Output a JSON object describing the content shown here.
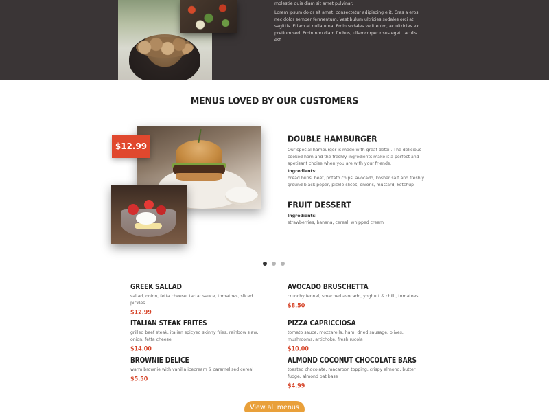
{
  "about": {
    "line1": "molestie quis diam sit amet pulvinar.",
    "paragraph": "Lorem ipsum dolor sit amet, consectetur adipiscing elit. Cras a eros nec dolor semper fermentum. Vestibulum ultricies sodales orci at sagittis. Etiam at nulla urna. Proin sodales velit enim, ac ultricies ex pretium sed. Proin non diam finibus, ullamcorper risus eget, iaculis est."
  },
  "section": {
    "title": "MENUS LOVED BY OUR CUSTOMERS"
  },
  "featured": {
    "price": "$12.99",
    "items": [
      {
        "title": "DOUBLE HAMBURGER",
        "description": "Our special hamburger is made with great detail. The delicious cooked ham and the freshly ingredients make it a perfect and apetisant choise when you are with your friends.",
        "ingredients_label": "Ingredients:",
        "ingredients": "bread buns, beef, potato chips, avocado, kosher salt and freshly ground black peper, pickle slices, onions, mustard, ketchup"
      },
      {
        "title": "FRUIT DESSERT",
        "ingredients_label": "Ingredients:",
        "ingredients": "strawberries, banana, cereal, whipped cream"
      }
    ],
    "slides": 3,
    "active_slide": 1
  },
  "menu": {
    "items": [
      {
        "name": "GREEK SALLAD",
        "description": "sallad, onion, fetta cheese, tartar sauce, tomatoes, sliced pickles",
        "price": "$12.99"
      },
      {
        "name": "AVOCADO BRUSCHETTA",
        "description": "crunchy fennel, smached avocado, yoghurt & chilli, tomatoes",
        "price": "$8.50"
      },
      {
        "name": "ITALIAN STEAK FRITES",
        "description": "grilled beef steak, italian spicyed skinny fries, rainbow slaw, onion, fetta cheese",
        "price": "$14.00"
      },
      {
        "name": "PIZZA CAPRICCIOSA",
        "description": "tomato sauce, mozzarella, ham, dried sausage, olives, mushrooms, artichoke, fresh rucola",
        "price": "$10.00"
      },
      {
        "name": "BROWNIE DELICE",
        "description": "warm brownie with vanilla icecream & caramelised cereal",
        "price": "$5.50"
      },
      {
        "name": "ALMOND COCONUT CHOCOLATE BARS",
        "description": "toasted chocolate, macaroon topping, crispy almond, butter fudge, almond oat base",
        "price": "$4.99"
      }
    ],
    "view_all_label": "View all menus"
  },
  "colors": {
    "dark_band": "#3a3536",
    "accent_red": "#e0482e",
    "price_red": "#d6452a",
    "button_orange": "#e9a03a"
  }
}
